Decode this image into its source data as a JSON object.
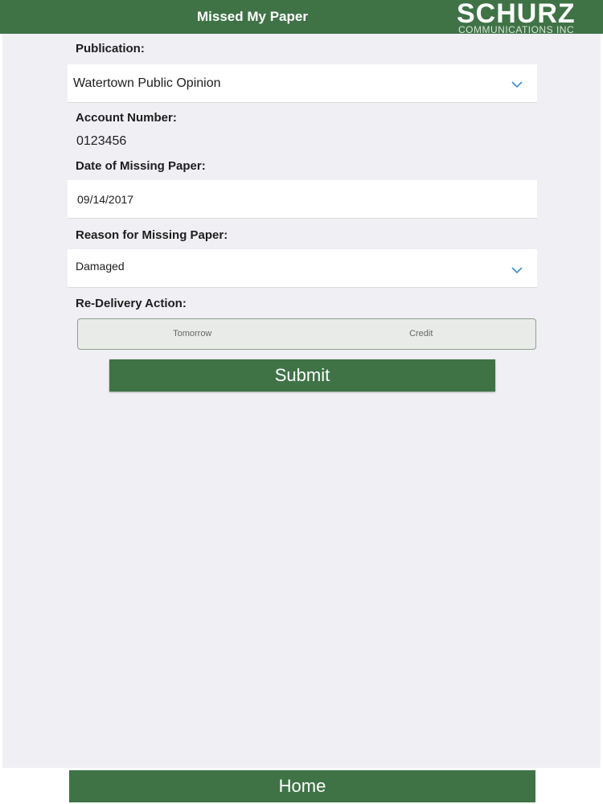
{
  "header": {
    "title": "Missed My Paper",
    "logo_word": "SCHURZ",
    "logo_sub": "COMMUNICATIONS INC"
  },
  "form": {
    "publication_label": "Publication:",
    "publication_value": "Watertown Public Opinion",
    "account_label": "Account Number:",
    "account_value": "0123456",
    "date_label": "Date of Missing Paper:",
    "date_value": "09/14/2017",
    "reason_label": "Reason for Missing Paper:",
    "reason_value": "Damaged",
    "redelivery_label": "Re-Delivery Action:",
    "redelivery_options": [
      "Tomorrow",
      "Credit"
    ],
    "submit_label": "Submit"
  },
  "footer": {
    "home_label": "Home"
  },
  "colors": {
    "accent": "#3f7346",
    "chevron": "#3a8fd6"
  },
  "icons": {
    "dropdown": "chevron-down-icon"
  }
}
